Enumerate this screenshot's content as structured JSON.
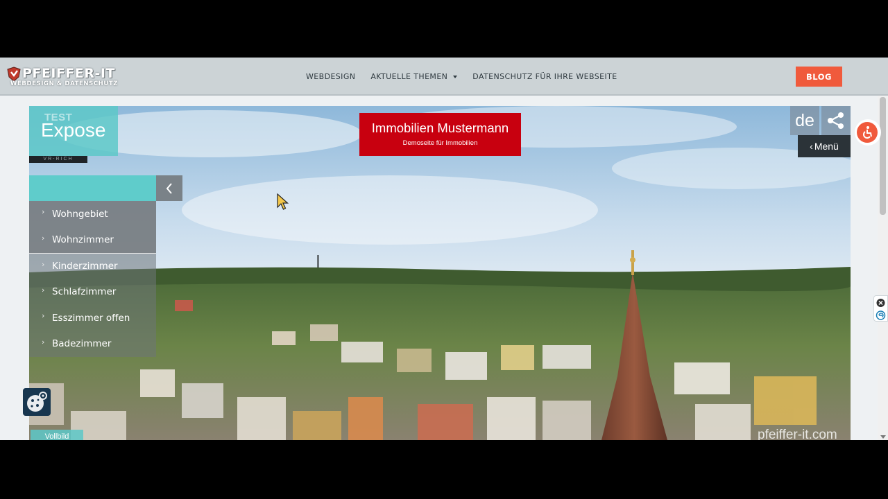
{
  "logo": {
    "name": "PFEIFFER-IT",
    "tagline": "WEBDESIGN & DATENSCHUTZ"
  },
  "nav": {
    "items": [
      {
        "label": "WEBDESIGN"
      },
      {
        "label": "AKTUELLE THEMEN",
        "has_dropdown": true
      },
      {
        "label": "DATENSCHUTZ FÜR IHRE WEBSEITE"
      }
    ],
    "blog_label": "BLOG"
  },
  "tour": {
    "title": "Expose",
    "vr_logo_text": "TEST",
    "vr_logo_bar": "VR-RICH",
    "brand_title": "Immobilien Mustermann",
    "brand_subtitle": "Demoseite für Immobilien",
    "language": "de",
    "menu_label": "Menü",
    "rooms": [
      {
        "label": "Wohngebiet"
      },
      {
        "label": "Wohnzimmer"
      },
      {
        "label": "Kinderzimmer"
      },
      {
        "label": "Schlafzimmer"
      },
      {
        "label": "Esszimmer offen"
      },
      {
        "label": "Badezimmer"
      }
    ],
    "fullscreen_label": "Vollbild",
    "watermark": "pfeiffer-it.com"
  },
  "colors": {
    "accent": "#f05a3c",
    "teal": "#5fcccb",
    "brand_red": "#c8000f",
    "header_bg": "#ccd3d6",
    "cookie_bg": "#17364f"
  },
  "icons": {
    "share": "share-icon",
    "accessibility": "accessibility-icon",
    "cookie": "cookie-settings-icon",
    "panel_toggle": "chevron-left-icon"
  }
}
